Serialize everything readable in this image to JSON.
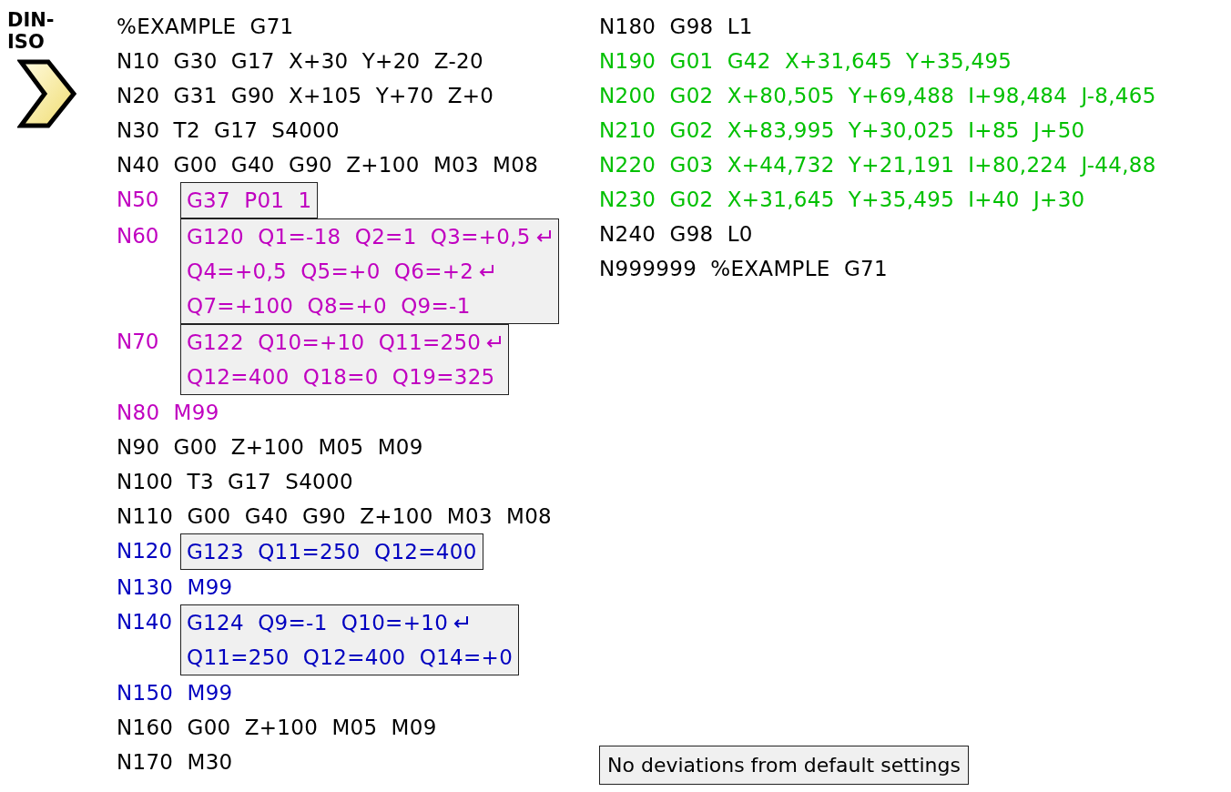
{
  "header": {
    "label": "DIN-ISO"
  },
  "left_lines": [
    {
      "text": "%EXAMPLE  G71",
      "color": "#000000"
    },
    {
      "text": "N10  G30  G17  X+30  Y+20  Z-20",
      "color": "#000000"
    },
    {
      "text": "N20  G31  G90  X+105  Y+70  Z+0",
      "color": "#000000"
    },
    {
      "text": "N30  T2  G17  S4000",
      "color": "#000000"
    },
    {
      "text": "N40  G00  G40  G90  Z+100  M03  M08",
      "color": "#000000"
    },
    {
      "number": "N50",
      "color": "#c000c0",
      "box": [
        {
          "text": "G37  P01  1",
          "wrap": false
        }
      ]
    },
    {
      "number": "N60",
      "color": "#c000c0",
      "box": [
        {
          "text": "G120  Q1=-18  Q2=1  Q3=+0,5",
          "wrap": true
        },
        {
          "text": "Q4=+0,5  Q5=+0  Q6=+2",
          "wrap": true
        },
        {
          "text": "Q7=+100  Q8=+0  Q9=-1",
          "wrap": false
        }
      ]
    },
    {
      "number": "N70",
      "color": "#c000c0",
      "box": [
        {
          "text": "G122  Q10=+10  Q11=250",
          "wrap": true
        },
        {
          "text": "Q12=400  Q18=0  Q19=325",
          "wrap": false
        }
      ]
    },
    {
      "text": "N80  M99",
      "color": "#c000c0"
    },
    {
      "text": "N90  G00  Z+100  M05  M09",
      "color": "#000000"
    },
    {
      "text": "N100  T3  G17  S4000",
      "color": "#000000"
    },
    {
      "text": "N110  G00  G40  G90  Z+100  M03  M08",
      "color": "#000000"
    },
    {
      "number": "N120",
      "color": "#0000c0",
      "box": [
        {
          "text": "G123  Q11=250  Q12=400",
          "wrap": false
        }
      ]
    },
    {
      "text": "N130  M99",
      "color": "#0000c0"
    },
    {
      "number": "N140",
      "color": "#0000c0",
      "box": [
        {
          "text": "G124  Q9=-1  Q10=+10",
          "wrap": true
        },
        {
          "text": "Q11=250  Q12=400  Q14=+0",
          "wrap": false
        }
      ]
    },
    {
      "text": "N150  M99",
      "color": "#0000c0"
    },
    {
      "text": "N160  G00  Z+100  M05  M09",
      "color": "#000000"
    },
    {
      "text": "N170  M30",
      "color": "#000000"
    }
  ],
  "right_lines": [
    {
      "text": "N180  G98  L1",
      "color": "#000000"
    },
    {
      "text": "N190  G01  G42  X+31,645  Y+35,495",
      "color": "#00c000"
    },
    {
      "text": "N200  G02  X+80,505  Y+69,488  I+98,484  J-8,465",
      "color": "#00c000"
    },
    {
      "text": "N210  G02  X+83,995  Y+30,025  I+85  J+50",
      "color": "#00c000"
    },
    {
      "text": "N220  G03  X+44,732  Y+21,191  I+80,224  J-44,88",
      "color": "#00c000"
    },
    {
      "text": "N230  G02  X+31,645  Y+35,495  I+40  J+30",
      "color": "#00c000"
    },
    {
      "text": "N240  G98  L0",
      "color": "#000000"
    },
    {
      "text": "N999999  %EXAMPLE  G71",
      "color": "#000000"
    }
  ],
  "note": "No deviations from default settings"
}
